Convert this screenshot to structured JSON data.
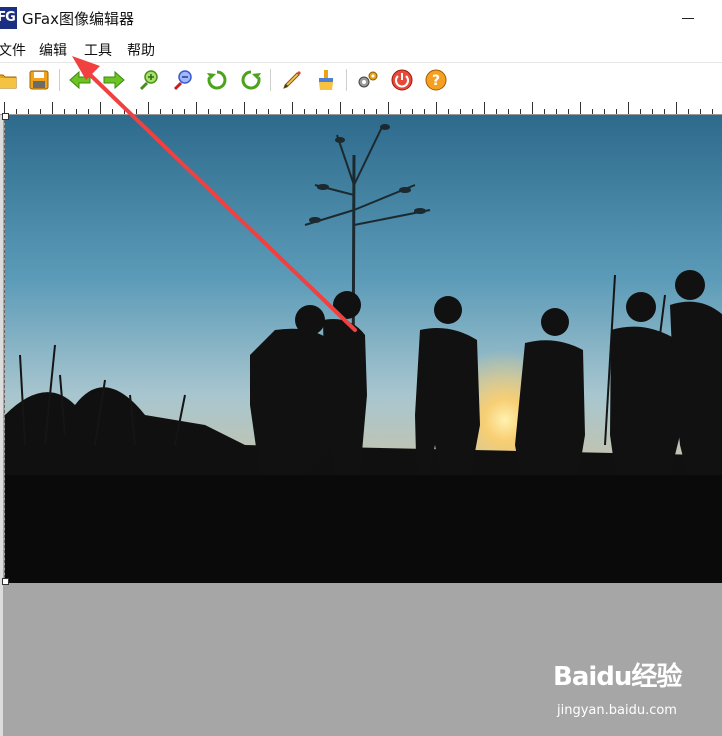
{
  "window": {
    "icon_text": "FG",
    "title": "GFax图像编辑器"
  },
  "menu": {
    "items": [
      "文件",
      "编辑",
      "工具",
      "帮助"
    ]
  },
  "toolbar": {
    "buttons": [
      "open-folder-icon",
      "save-disk-icon",
      "back-arrow-icon",
      "forward-arrow-icon",
      "zoom-in-icon",
      "zoom-out-icon",
      "rotate-left-icon",
      "rotate-right-icon",
      "pen-icon",
      "brush-icon",
      "settings-icon",
      "power-icon",
      "help-icon"
    ]
  },
  "canvas": {
    "image_description": "silhouettes-at-sunset-photo"
  },
  "watermark": {
    "logo": "Baidu经验",
    "url": "jingyan.baidu.com"
  },
  "colors": {
    "accent_arrow": "#f04040",
    "canvas_background": "#a6a6a6",
    "sky_top": "#2f6e8e",
    "sun": "#ffd27a"
  }
}
